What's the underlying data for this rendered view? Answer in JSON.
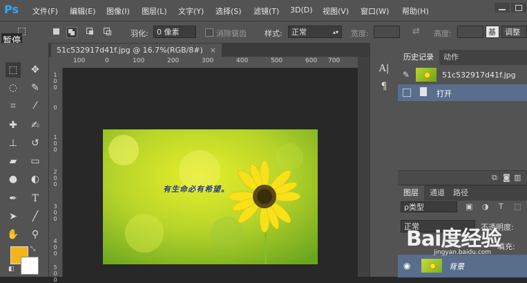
{
  "app": {
    "logo": "Ps"
  },
  "menu": [
    "文件(F)",
    "编辑(E)",
    "图像(I)",
    "图层(L)",
    "文字(Y)",
    "选择(S)",
    "滤镜(T)",
    "3D(D)",
    "视图(V)",
    "窗口(W)",
    "帮助(H)"
  ],
  "options_bar": {
    "feather_label": "羽化:",
    "feather_value": "0 像素",
    "antialias_label": "消除锯齿",
    "style_label": "样式:",
    "style_value": "正常",
    "width_label": "宽度:",
    "height_label": "高度:",
    "refine_label": "调整",
    "partial_button": "基"
  },
  "status": {
    "paused": "暂停"
  },
  "document": {
    "tab_title": "51c532917d41f.jpg @ 16.7%(RGB/8#)",
    "close": "×",
    "ruler_h": [
      "100",
      "0",
      "100",
      "200",
      "300",
      "400",
      "500",
      "600",
      "700"
    ],
    "ruler_v": [
      "1\n0\n0",
      "0",
      "1\n0\n0",
      "2\n0\n0",
      "3\n0\n0",
      "4\n0\n0",
      "5\n0\n0"
    ],
    "image_caption": "有生命必有希望。"
  },
  "history_panel": {
    "tabs": [
      "历史记录",
      "动作"
    ],
    "snapshot": "51c532917d41f.jpg",
    "step": "打开"
  },
  "layers_panel": {
    "tabs": [
      "图层",
      "通道",
      "路径"
    ],
    "filter": "ρ类型",
    "blend_mode": "正常",
    "opacity_label": "不透明度:",
    "fill_label": "填充:",
    "layer_name": "背景"
  },
  "watermark": {
    "logo": "Bai度经验",
    "url": "jingyan.baidu.com"
  },
  "colors": {
    "foreground": "#f3b519",
    "background": "#ffffff",
    "accent": "#31a8ff",
    "selection": "#596d8c"
  },
  "icons": [
    "marquee-icon",
    "move-icon",
    "lasso-icon",
    "quick-select-icon",
    "crop-icon",
    "eyedropper-icon",
    "healing-icon",
    "brush-icon",
    "stamp-icon",
    "history-brush-icon",
    "eraser-icon",
    "gradient-icon",
    "blur-icon",
    "dodge-icon",
    "pen-icon",
    "type-icon",
    "path-select-icon",
    "line-icon",
    "hand-icon",
    "zoom-icon"
  ]
}
